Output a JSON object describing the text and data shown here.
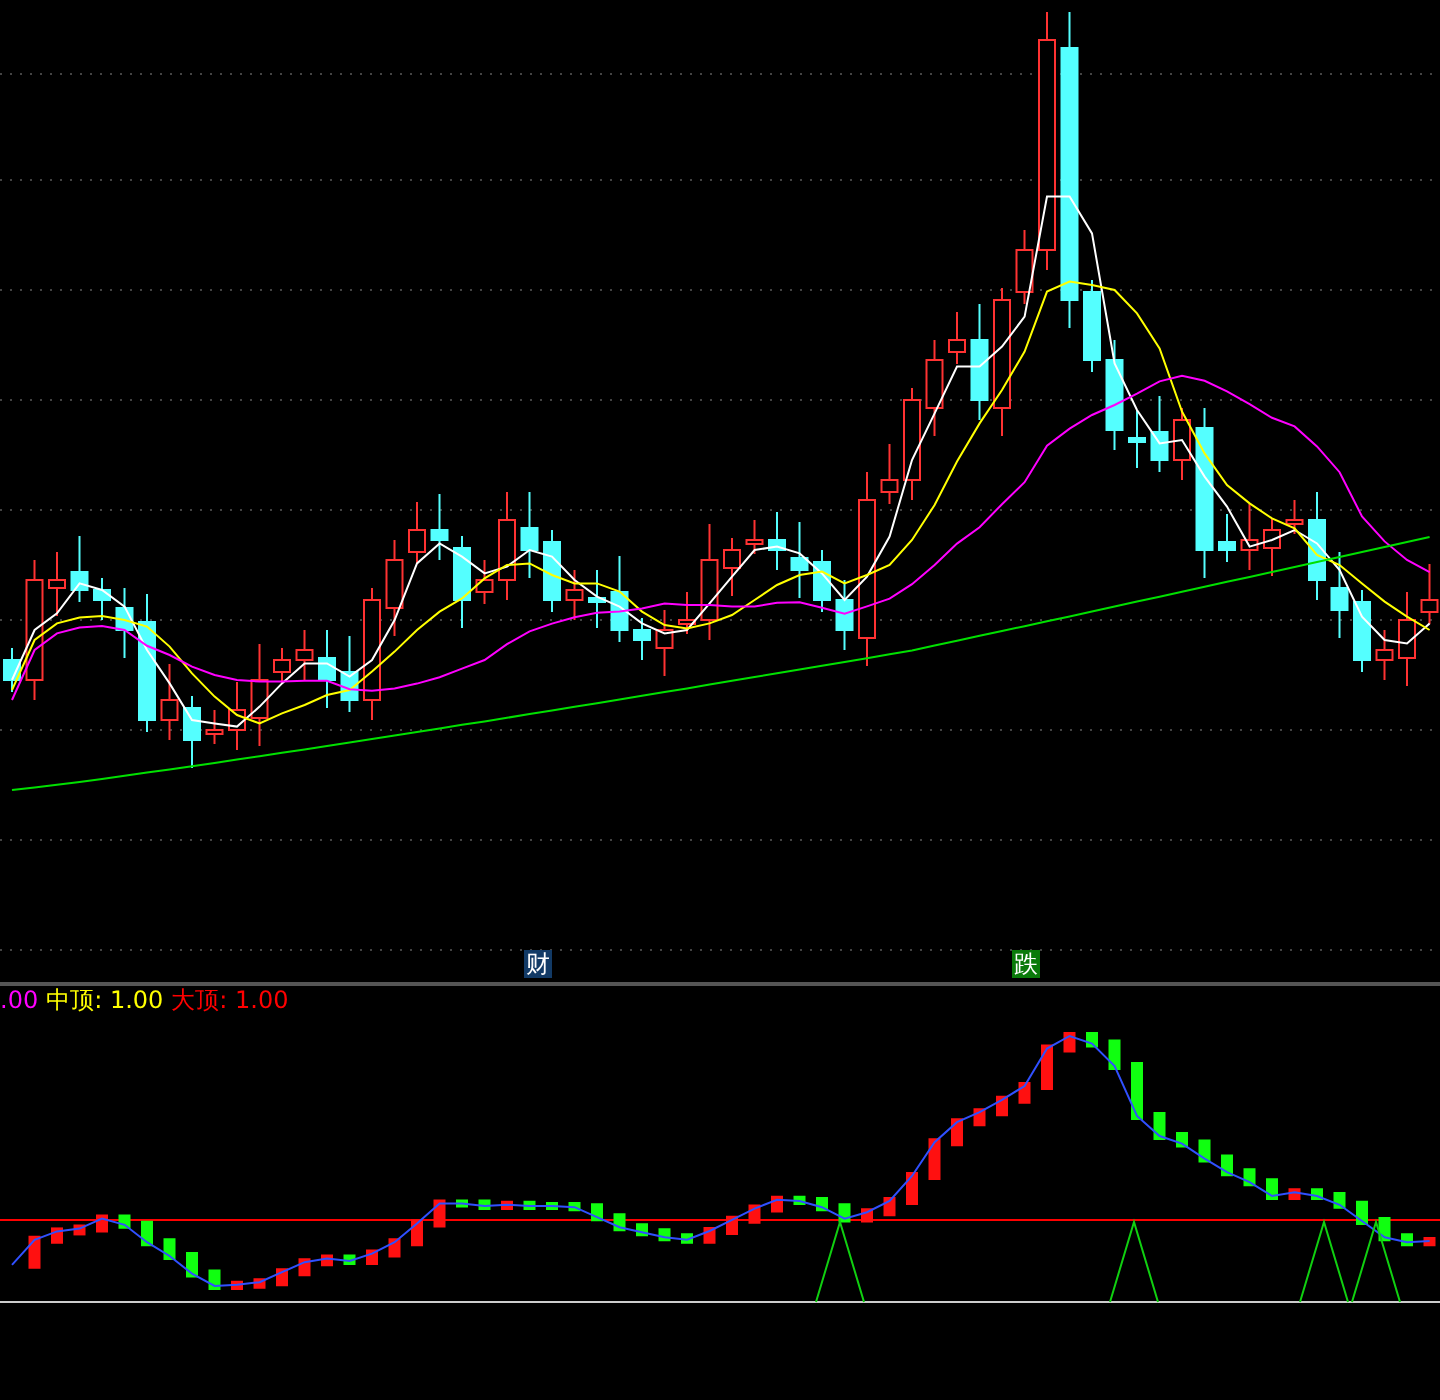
{
  "price_panel": {
    "markers": [
      {
        "text": "财",
        "kind": "news"
      },
      {
        "text": "跌",
        "kind": "fall"
      }
    ]
  },
  "indicator_panel": {
    "legend": [
      {
        "text": ".00",
        "color": "#ff00ff"
      },
      {
        "text": "中顶: 1.00",
        "color": "#ffff00"
      },
      {
        "text": "大顶: 1.00",
        "color": "#ff0000"
      }
    ]
  }
}
